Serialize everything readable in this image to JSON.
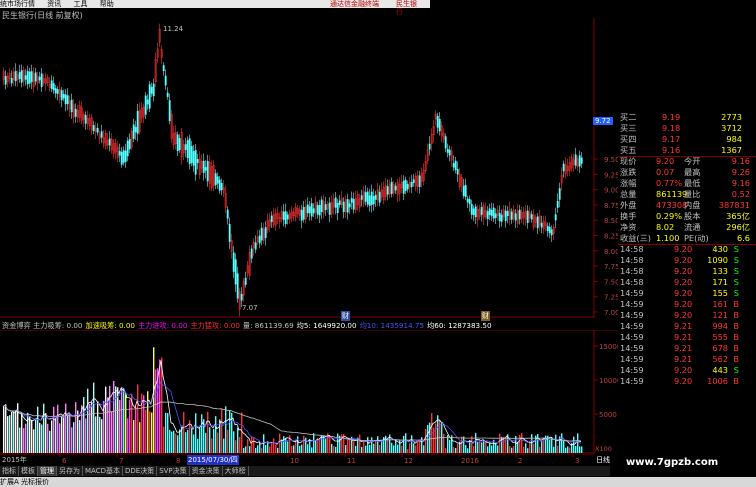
{
  "menubar": {
    "items": [
      "统市场行情",
      "资讯",
      "工具",
      "帮助"
    ],
    "ticker1": "通达信金融终端",
    "ticker2": "民生银行"
  },
  "chart_title": "民生银行(日线 前复权)",
  "price_axis": {
    "ticks": [
      "9.50",
      "9.25",
      "9.00",
      "8.75",
      "8.50",
      "8.25",
      "8.00",
      "7.75",
      "7.50",
      "7.25",
      "7.00"
    ],
    "current": "9.72",
    "labels": {
      "high": "11.24",
      "low": "7.07"
    }
  },
  "markers": [
    "财",
    "财"
  ],
  "volume_legend": {
    "items": [
      {
        "label": "资金博弈 主力吸筹: 0.00",
        "color": "#c0c0c0"
      },
      {
        "label": "加速吸筹: 0.00",
        "color": "#ffff00"
      },
      {
        "label": "主力进攻: 0.00",
        "color": "#ff00ff"
      },
      {
        "label": "主力猛攻: 0.00",
        "color": "#ff3030"
      },
      {
        "label": "量: 861139.69",
        "color": "#c0c0c0"
      },
      {
        "label": "均5: 1649920.00",
        "color": "#ffffff"
      },
      {
        "label": "均10: 1435914.75",
        "color": "#5050ff"
      },
      {
        "label": "均60: 1287383.50",
        "color": "#ffffff"
      }
    ]
  },
  "volume_axis": {
    "ticks": [
      "15000",
      "10000",
      "5000"
    ],
    "unit": "X100"
  },
  "date_axis": {
    "start": "2015年",
    "highlight": "2015/07/30/四",
    "months": [
      "6",
      "7",
      "8",
      "9",
      "10",
      "11",
      "12",
      "2016",
      "2",
      "3"
    ],
    "end": "日线"
  },
  "quote": {
    "bids": [
      {
        "label": "买二",
        "price": "9.19",
        "vol": "2773"
      },
      {
        "label": "买三",
        "price": "9.18",
        "vol": "3712"
      },
      {
        "label": "买四",
        "price": "9.17",
        "vol": "984"
      },
      {
        "label": "买五",
        "price": "9.16",
        "vol": "1367"
      }
    ],
    "stats": [
      [
        "现价",
        "9.20",
        "今开",
        "9.16"
      ],
      [
        "涨跌",
        "0.07",
        "最高",
        "9.26"
      ],
      [
        "涨幅",
        "0.77%",
        "最低",
        "9.16"
      ],
      [
        "总量",
        "861139",
        "量比",
        "0.52"
      ],
      [
        "外盘",
        "473308",
        "内盘",
        "387831"
      ],
      [
        "换手",
        "0.29%",
        "股本",
        "365亿"
      ],
      [
        "净资",
        "8.02",
        "流通",
        "296亿"
      ],
      [
        "收益(三)",
        "1.100",
        "PE(动)",
        "6.6"
      ]
    ],
    "ticks": [
      [
        "14:58",
        "9.20",
        "430",
        "S"
      ],
      [
        "14:58",
        "9.20",
        "1090",
        "S"
      ],
      [
        "14:58",
        "9.20",
        "133",
        "S"
      ],
      [
        "14:58",
        "9.20",
        "171",
        "S"
      ],
      [
        "14:59",
        "9.20",
        "155",
        "S"
      ],
      [
        "14:59",
        "9.20",
        "161",
        "B"
      ],
      [
        "14:59",
        "9.20",
        "121",
        "B"
      ],
      [
        "14:59",
        "9.21",
        "994",
        "B"
      ],
      [
        "14:59",
        "9.21",
        "555",
        "B"
      ],
      [
        "14:59",
        "9.21",
        "678",
        "B"
      ],
      [
        "14:59",
        "9.21",
        "562",
        "B"
      ],
      [
        "14:59",
        "9.20",
        "443",
        "S"
      ],
      [
        "14:59",
        "9.20",
        "1006",
        "B"
      ]
    ]
  },
  "tabs": [
    "指标",
    "模板",
    "管理",
    "另存为",
    "MACD基本",
    "DDE决策",
    "SVP决策",
    "资金决策",
    "大师榜"
  ],
  "active_tab": "管理",
  "status": "扩展A  光标报价",
  "watermark": "www.7gpzb.com",
  "colors": {
    "up": "#ff3232",
    "down": "#54ffff",
    "bg": "#000000",
    "grid": "#800000"
  }
}
